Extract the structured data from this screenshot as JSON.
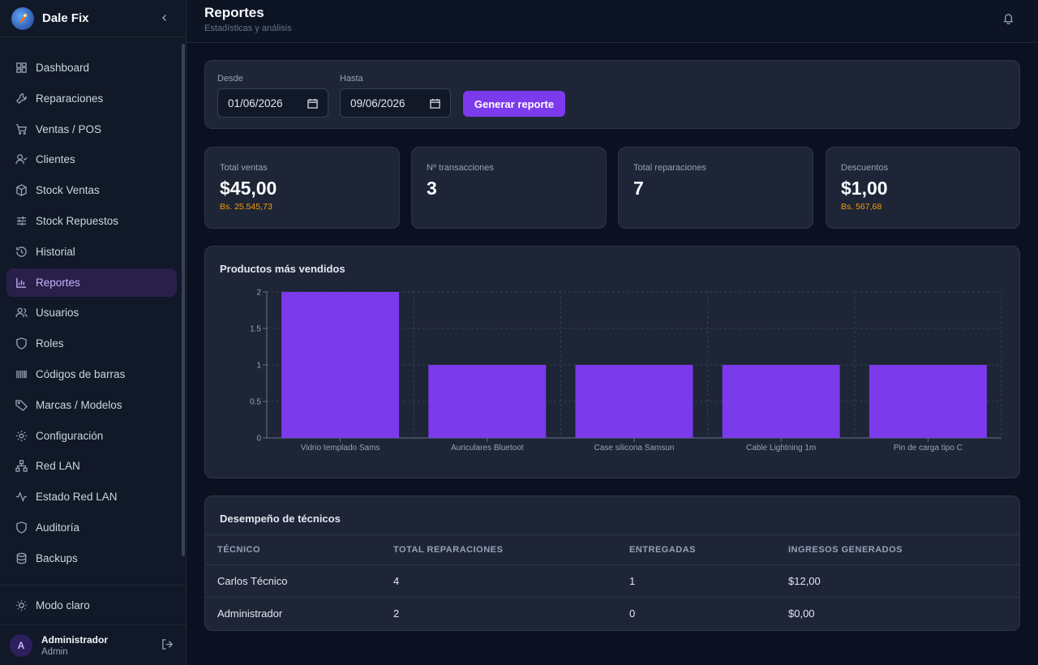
{
  "app": {
    "name": "Dale Fix"
  },
  "sidebar": {
    "items": [
      {
        "label": "Dashboard",
        "icon": "dashboard-icon"
      },
      {
        "label": "Reparaciones",
        "icon": "wrench-icon"
      },
      {
        "label": "Ventas / POS",
        "icon": "cart-icon"
      },
      {
        "label": "Clientes",
        "icon": "user-check-icon"
      },
      {
        "label": "Stock Ventas",
        "icon": "box-icon"
      },
      {
        "label": "Stock Repuestos",
        "icon": "sliders-icon"
      },
      {
        "label": "Historial",
        "icon": "history-icon"
      },
      {
        "label": "Reportes",
        "icon": "bar-chart-icon",
        "active": true
      },
      {
        "label": "Usuarios",
        "icon": "users-icon"
      },
      {
        "label": "Roles",
        "icon": "shield-icon"
      },
      {
        "label": "Códigos de barras",
        "icon": "barcode-icon"
      },
      {
        "label": "Marcas / Modelos",
        "icon": "tag-icon"
      },
      {
        "label": "Configuración",
        "icon": "gear-icon"
      },
      {
        "label": "Red LAN",
        "icon": "network-icon"
      },
      {
        "label": "Estado Red LAN",
        "icon": "activity-icon"
      },
      {
        "label": "Auditoría",
        "icon": "shield-icon"
      },
      {
        "label": "Backups",
        "icon": "database-icon"
      }
    ],
    "mode_label": "Modo claro",
    "user": {
      "initial": "A",
      "name": "Administrador",
      "role": "Admin"
    }
  },
  "header": {
    "title": "Reportes",
    "subtitle": "Estadísticas y análisis"
  },
  "filters": {
    "from_label": "Desde",
    "from_value": "01/06/2026",
    "to_label": "Hasta",
    "to_value": "09/06/2026",
    "generate_label": "Generar reporte"
  },
  "stats": [
    {
      "label": "Total ventas",
      "value": "$45,00",
      "sub": "Bs. 25.545,73"
    },
    {
      "label": "Nº transacciones",
      "value": "3",
      "sub": ""
    },
    {
      "label": "Total reparaciones",
      "value": "7",
      "sub": ""
    },
    {
      "label": "Descuentos",
      "value": "$1,00",
      "sub": "Bs. 567,68"
    }
  ],
  "chart_section": {
    "title": "Productos más vendidos"
  },
  "chart_data": {
    "type": "bar",
    "categories": [
      "Vidrio templado Sams",
      "Auriculares Bluetoot",
      "Case silicona Samsun",
      "Cable Lightning 1m",
      "Pin de carga tipo C"
    ],
    "values": [
      2,
      1,
      1,
      1,
      1
    ],
    "yticks": [
      "0",
      "0.5",
      "1",
      "1.5",
      "2"
    ],
    "ylim": [
      0,
      2
    ],
    "grid": true,
    "bar_color": "#7c3aed"
  },
  "technicians": {
    "title": "Desempeño de técnicos",
    "columns": [
      "TÉCNICO",
      "TOTAL REPARACIONES",
      "ENTREGADAS",
      "INGRESOS GENERADOS"
    ],
    "rows": [
      [
        "Carlos Técnico",
        "4",
        "1",
        "$12,00"
      ],
      [
        "Administrador",
        "2",
        "0",
        "$0,00"
      ]
    ]
  }
}
